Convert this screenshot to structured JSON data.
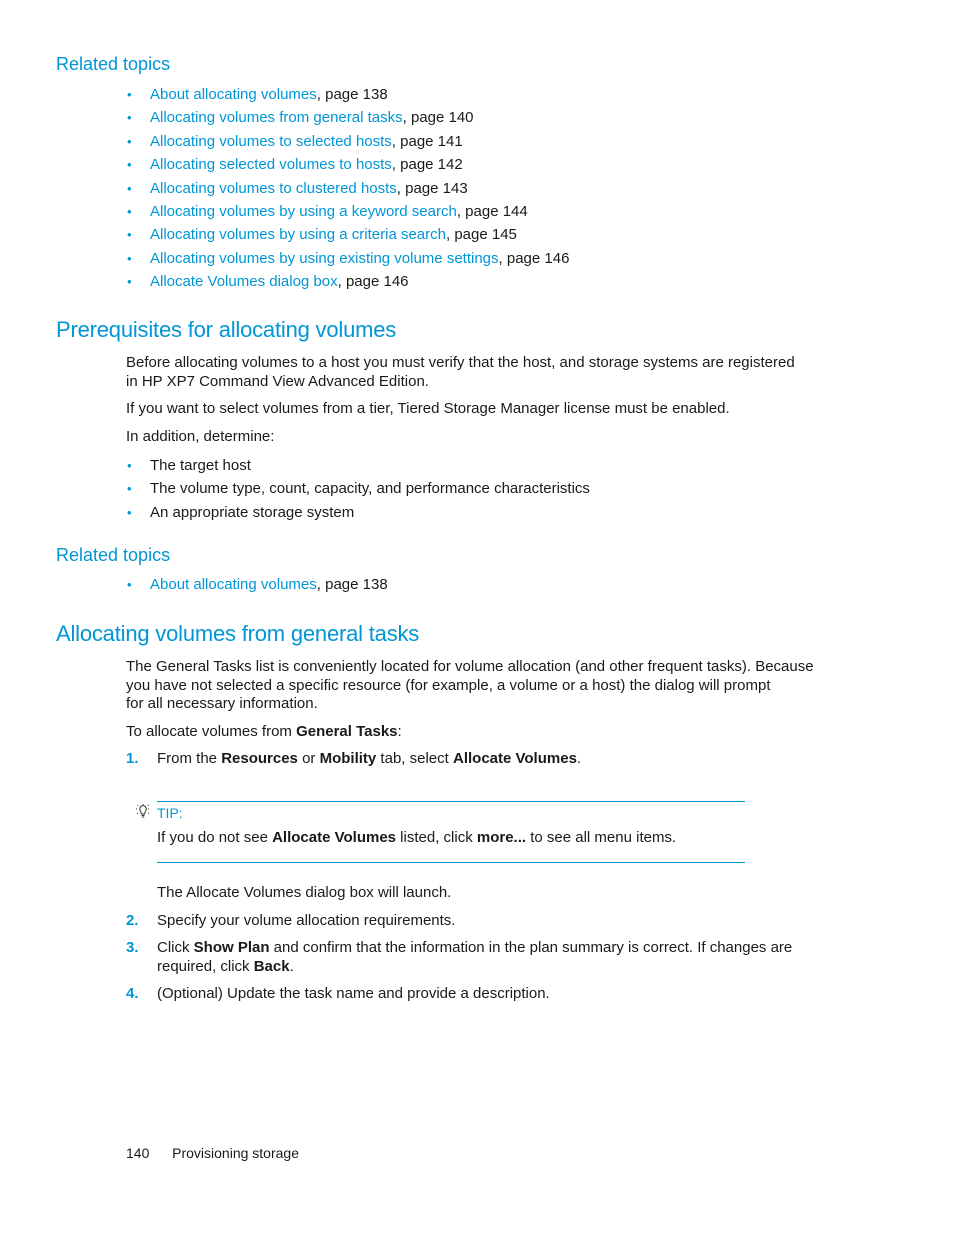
{
  "related_topics_1": {
    "heading": "Related topics",
    "items": [
      {
        "link": "About allocating volumes",
        "suffix": ", page 138"
      },
      {
        "link": "Allocating volumes from general tasks",
        "suffix": ", page 140"
      },
      {
        "link": "Allocating volumes to selected hosts",
        "suffix": ", page 141"
      },
      {
        "link": "Allocating selected volumes to hosts",
        "suffix": ", page 142"
      },
      {
        "link": "Allocating volumes to clustered hosts",
        "suffix": ", page 143"
      },
      {
        "link": "Allocating volumes by using a keyword search",
        "suffix": ", page 144"
      },
      {
        "link": "Allocating volumes by using a criteria search",
        "suffix": ", page 145"
      },
      {
        "link": "Allocating volumes by using existing volume settings",
        "suffix": ", page 146"
      },
      {
        "link": "Allocate Volumes dialog box",
        "suffix": ", page 146"
      }
    ]
  },
  "prerequisites": {
    "heading": "Prerequisites for allocating volumes",
    "para1_line1": "Before allocating volumes to a host you must verify that the host, and storage systems are registered",
    "para1_line2": "in HP XP7 Command View Advanced Edition.",
    "para2": "If you want to select volumes from a tier, Tiered Storage Manager license must be enabled.",
    "para3": "In addition, determine:",
    "bullets": [
      "The target host",
      "The volume type, count, capacity, and performance characteristics",
      "An appropriate storage system"
    ]
  },
  "related_topics_2": {
    "heading": "Related topics",
    "items": [
      {
        "link": "About allocating volumes",
        "suffix": ", page 138"
      }
    ]
  },
  "general_tasks": {
    "heading": "Allocating volumes from general tasks",
    "intro_line1": "The General Tasks list is conveniently located for volume allocation (and other frequent tasks). Because",
    "intro_line2": "you have not selected a specific resource (for example, a volume or a host) the dialog will prompt",
    "intro_line3": "for all necessary information.",
    "lead_text": "To allocate volumes from ",
    "lead_bold": "General Tasks",
    "lead_end": ":",
    "step1": {
      "num": "1.",
      "t1": "From the ",
      "b1": "Resources",
      "t2": " or ",
      "b2": "Mobility",
      "t3": " tab, select ",
      "b3": "Allocate Volumes",
      "t4": "."
    },
    "tip": {
      "label": "TIP:",
      "t1": "If you do not see ",
      "b1": "Allocate Volumes",
      "t2": " listed, click ",
      "b2": "more...",
      "t3": " to see all menu items."
    },
    "after_tip": "The Allocate Volumes dialog box will launch.",
    "step2": {
      "num": "2.",
      "text": "Specify your volume allocation requirements."
    },
    "step3": {
      "num": "3.",
      "t1": "Click ",
      "b1": "Show Plan",
      "t2": " and confirm that the information in the plan summary is correct. If changes are",
      "t3": "required, click ",
      "b2": "Back",
      "t4": "."
    },
    "step4": {
      "num": "4.",
      "text": "(Optional) Update the task name and provide a description."
    }
  },
  "footer": {
    "page_number": "140",
    "section": "Provisioning storage"
  }
}
